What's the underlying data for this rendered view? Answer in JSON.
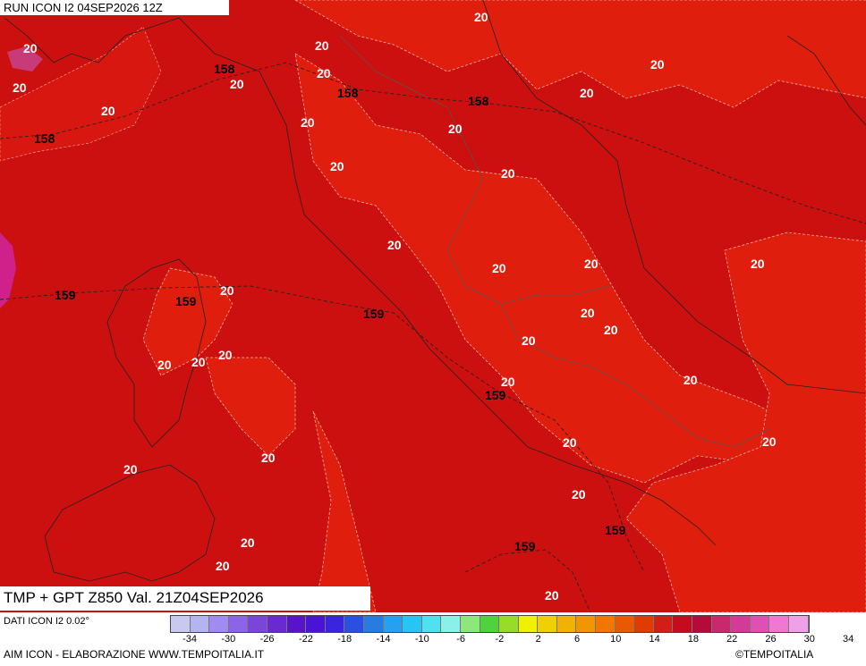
{
  "header": {
    "run": "RUN ICON I2 04SEP2026 12Z"
  },
  "map": {
    "field_title": "TMP + GPT Z850 Val. 21Z04SEP2026",
    "colors": {
      "base": "#cc1010",
      "warm": "#e01e0e",
      "hot_spot": "#d0208a"
    },
    "temperature_labels": [
      "20",
      "20",
      "20",
      "20",
      "20",
      "20",
      "20",
      "20",
      "20",
      "20",
      "20",
      "20",
      "20",
      "20",
      "20",
      "20",
      "20",
      "20",
      "20",
      "20",
      "20",
      "20",
      "20",
      "20",
      "20",
      "20",
      "20",
      "20",
      "20",
      "20",
      "20",
      "20",
      "20",
      "20"
    ],
    "gpt_labels": [
      "158",
      "158",
      "158",
      "158",
      "159",
      "159",
      "159",
      "159",
      "159",
      "159"
    ]
  },
  "footer": {
    "dati": "DATI ICON I2 0.02°",
    "aim": "AIM ICON - ELABORAZIONE WWW.TEMPOITALIA.IT",
    "credit": "©TEMPOITALIA"
  },
  "legend": {
    "colors": [
      "#c8c8f0",
      "#b4b4f0",
      "#a08cf0",
      "#8c64e6",
      "#7a46d8",
      "#6a2ad0",
      "#5a14c8",
      "#4a14d8",
      "#3a24e0",
      "#2a50e0",
      "#287ce0",
      "#28a0f0",
      "#28c4f4",
      "#50e0f0",
      "#8cf0e8",
      "#8ce87a",
      "#50d23c",
      "#96dc28",
      "#f0f000",
      "#f0d000",
      "#f0b400",
      "#f09600",
      "#f07800",
      "#e85a00",
      "#e03c00",
      "#d21e14",
      "#c80a1e",
      "#b40a3c",
      "#c8286e",
      "#d23c96",
      "#e050b4",
      "#f078d2",
      "#f0a0e6"
    ],
    "ticks": [
      "-34",
      "-30",
      "-26",
      "-22",
      "-18",
      "-14",
      "-10",
      "-6",
      "-2",
      "2",
      "6",
      "10",
      "14",
      "18",
      "22",
      "26",
      "30",
      "34"
    ]
  }
}
